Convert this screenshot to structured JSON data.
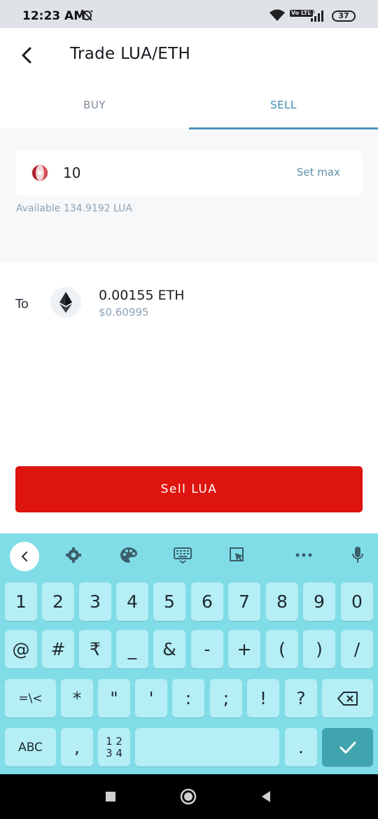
{
  "status_bar": {
    "time": "12:23 AM",
    "volte": "Vo LTE",
    "network": "4G",
    "battery": "37"
  },
  "header": {
    "title": "Trade LUA/ETH"
  },
  "tabs": [
    {
      "label": "BUY",
      "active": false
    },
    {
      "label": "SELL",
      "active": true
    }
  ],
  "sell_form": {
    "amount_value": "10",
    "set_max_label": "Set max",
    "available_text": "Available 134.9192 LUA",
    "to_label": "To",
    "receive_amount": "0.00155 ETH",
    "receive_usd": "$0.60995",
    "submit_label": "Sell LUA"
  },
  "keyboard": {
    "row1": [
      "1",
      "2",
      "3",
      "4",
      "5",
      "6",
      "7",
      "8",
      "9",
      "0"
    ],
    "row2": [
      "@",
      "#",
      "₹",
      "_",
      "&",
      "-",
      "+",
      "(",
      ")",
      "/"
    ],
    "row3": [
      "=\\<",
      "*",
      "\"",
      "'",
      ":",
      ";",
      "!",
      "?"
    ],
    "row4": {
      "abc": "ABC",
      "comma": ",",
      "numpad_top": "1 2",
      "numpad_bottom": "3 4",
      "period": "."
    }
  },
  "colors": {
    "accent": "#4d95b8",
    "sell_button": "#de140f",
    "keyboard_bg": "#80dde8",
    "key_bg": "#b5eef5",
    "enter_key": "#3fa4ae"
  }
}
